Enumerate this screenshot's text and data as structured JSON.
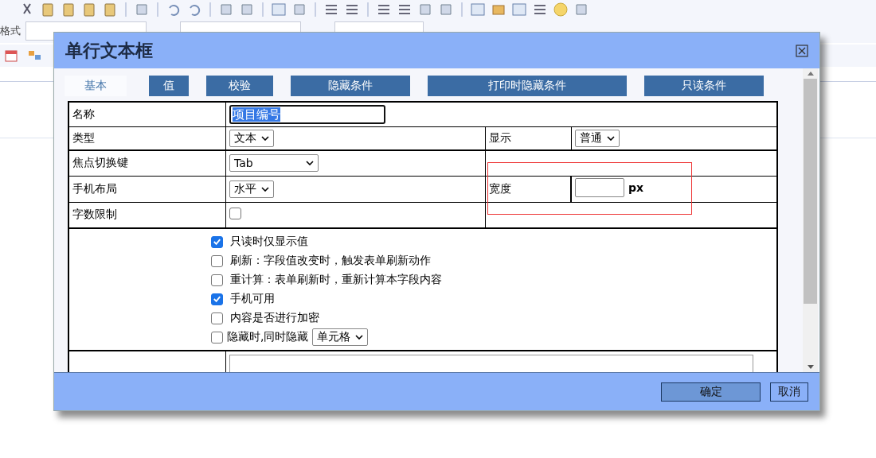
{
  "editor_toolbar": {
    "labels": [
      "格式"
    ]
  },
  "dialog": {
    "title": "单行文本框",
    "tabs": [
      {
        "label": "基本",
        "selected": true
      },
      {
        "label": "值",
        "selected": false
      },
      {
        "label": "校验",
        "selected": false
      },
      {
        "label": "隐藏条件",
        "selected": false
      },
      {
        "label": "打印时隐藏条件",
        "selected": false
      },
      {
        "label": "只读条件",
        "selected": false
      }
    ],
    "form": {
      "name": {
        "label": "名称",
        "value": "项目编号",
        "highlighted": true
      },
      "type": {
        "label": "类型",
        "value": "文本"
      },
      "display": {
        "label": "显示",
        "value": "普通"
      },
      "focus_key": {
        "label": "焦点切换键",
        "value": "Tab"
      },
      "mobile_layout": {
        "label": "手机布局",
        "value": "水平"
      },
      "width": {
        "label": "宽度",
        "unit": "px"
      },
      "char_limit": {
        "label": "字数限制",
        "checked": false
      },
      "options": [
        {
          "kind": "checkbox",
          "label": "只读时仅显示值",
          "checked": true
        },
        {
          "kind": "checkbox",
          "label": "刷新：字段值改变时，触发表单刷新动作",
          "checked": false
        },
        {
          "kind": "checkbox",
          "label": "重计算：表单刷新时，重新计算本字段内容",
          "checked": false
        },
        {
          "kind": "checkbox",
          "label": "手机可用",
          "checked": true
        },
        {
          "kind": "checkbox",
          "label": "内容是否进行加密",
          "checked": false
        },
        {
          "kind": "checkbox_select",
          "label": "隐藏时,同时隐藏",
          "checked": false,
          "select_value": "单元格"
        }
      ]
    },
    "buttons": [
      {
        "label": "确定",
        "kind": "primary"
      },
      {
        "label": "取消",
        "kind": "secondary"
      }
    ]
  }
}
